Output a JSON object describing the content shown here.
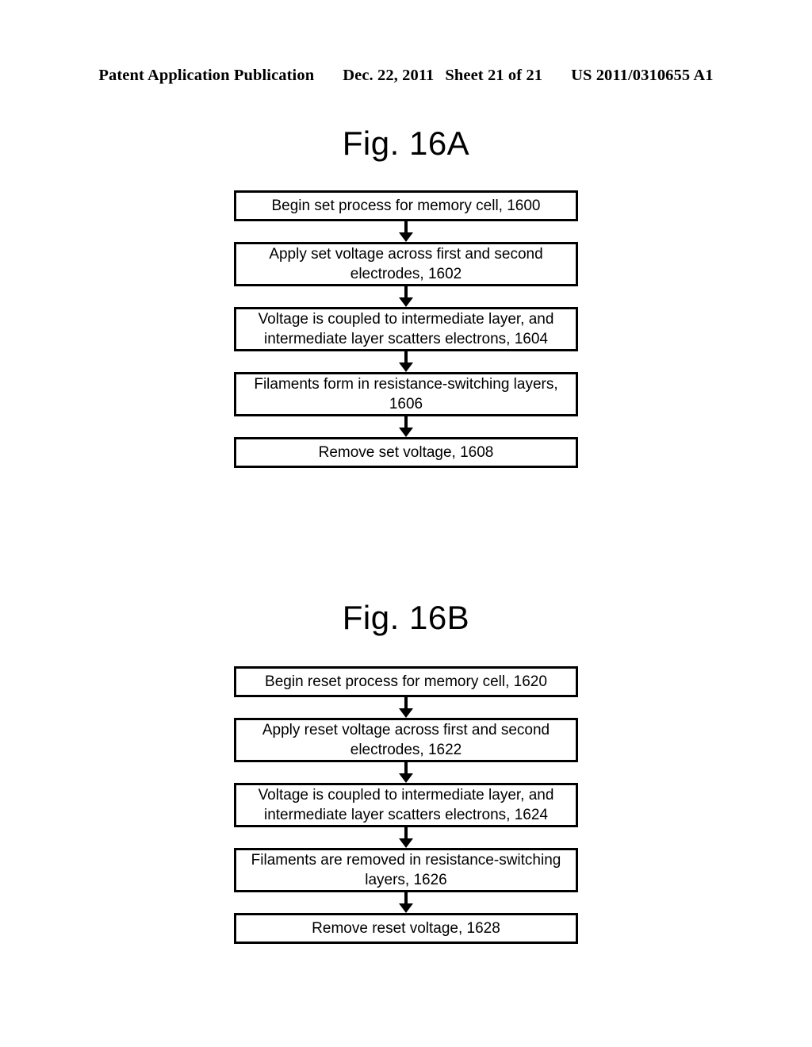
{
  "header": {
    "publication_label": "Patent Application Publication",
    "date": "Dec. 22, 2011",
    "sheet": "Sheet 21 of 21",
    "publication_number": "US 2011/0310655 A1"
  },
  "figures": [
    {
      "id": "fig-16a",
      "title": "Fig. 16A",
      "nodes": [
        {
          "text": "Begin set process for memory cell, 1600",
          "lines": 1
        },
        {
          "text": "Apply set voltage across first and second electrodes, 1602",
          "lines": 2
        },
        {
          "text": "Voltage is coupled to intermediate layer, and intermediate layer scatters electrons, 1604",
          "lines": 2
        },
        {
          "text": "Filaments form in resistance-switching layers, 1606",
          "lines": 2
        },
        {
          "text": "Remove set voltage, 1608",
          "lines": 1
        }
      ]
    },
    {
      "id": "fig-16b",
      "title": "Fig. 16B",
      "nodes": [
        {
          "text": "Begin reset process for memory cell, 1620",
          "lines": 1
        },
        {
          "text": "Apply reset voltage across first and second electrodes, 1622",
          "lines": 2
        },
        {
          "text": "Voltage is coupled to intermediate layer, and intermediate layer scatters electrons, 1624",
          "lines": 2
        },
        {
          "text": "Filaments are removed in resistance-switching layers, 1626",
          "lines": 2
        },
        {
          "text": "Remove reset voltage, 1628",
          "lines": 1
        }
      ]
    }
  ],
  "colors": {
    "ink": "#000000",
    "paper": "#ffffff"
  }
}
